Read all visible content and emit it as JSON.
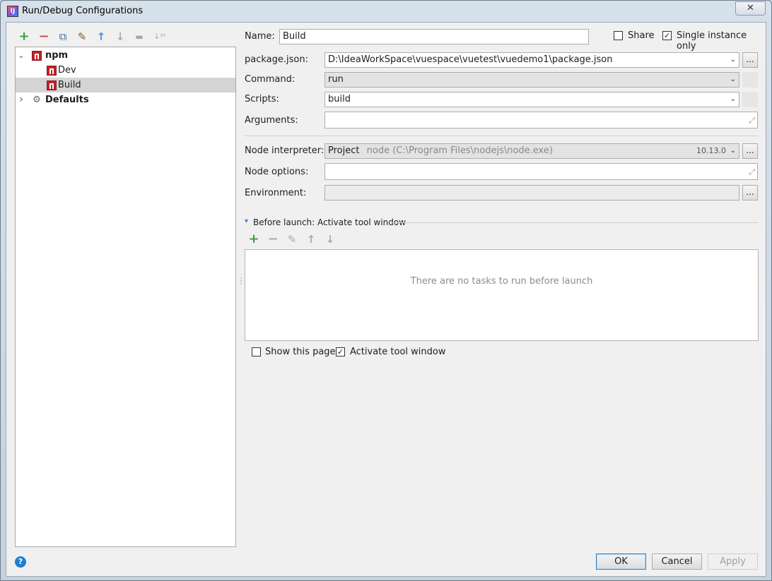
{
  "window": {
    "title": "Run/Debug Configurations",
    "app_icon_text": "IJ"
  },
  "toolbar": {
    "add": "+",
    "remove": "−",
    "copy": "⧉",
    "edit": "✎",
    "up": "↑",
    "down": "↓",
    "folder": "▬",
    "sort": "↓ᵃᶻ"
  },
  "tree": {
    "items": [
      {
        "label": "npm",
        "expanded_glyph": "⌄"
      },
      {
        "label": "Dev"
      },
      {
        "label": "Build"
      },
      {
        "label": "Defaults",
        "collapsed_glyph": "›"
      }
    ]
  },
  "form": {
    "name_label": "Name:",
    "name_value": "Build",
    "share_label": "Share",
    "single_instance_label": "Single instance only",
    "single_instance_checked": true,
    "package_json_label": "package.json:",
    "package_json_value": "D:\\IdeaWorkSpace\\vuespace\\vuetest\\vuedemo1\\package.json",
    "command_label": "Command:",
    "command_value": "run",
    "scripts_label": "Scripts:",
    "scripts_value": "build",
    "arguments_label": "Arguments:",
    "node_interpreter_label": "Node interpreter:",
    "node_interpreter_project": "Project",
    "node_interpreter_path": "node (C:\\Program Files\\nodejs\\node.exe)",
    "node_interpreter_version": "10.13.0",
    "node_options_label": "Node options:",
    "environment_label": "Environment:",
    "browse_label": "...",
    "dropdown_glyph": "⌄",
    "expand_glyph": "⤢"
  },
  "before_launch": {
    "title": "Before launch: Activate tool window",
    "expand_glyph": "▾",
    "empty_text": "There are no tasks to run before launch",
    "tb_add": "+",
    "tb_remove": "−",
    "tb_edit": "✎",
    "tb_up": "↑",
    "tb_down": "↓"
  },
  "options": {
    "show_page_label": "Show this page",
    "activate_label": "Activate tool window",
    "activate_checked": true
  },
  "buttons": {
    "ok": "OK",
    "cancel": "Cancel",
    "apply": "Apply",
    "help": "?",
    "close": "✕"
  },
  "colors": {
    "accent_green": "#3ca03c",
    "remove_red": "#d14f4f",
    "npm_red": "#c12127",
    "help_blue": "#1f7fd1",
    "arrow_blue": "#4a8fd6"
  }
}
